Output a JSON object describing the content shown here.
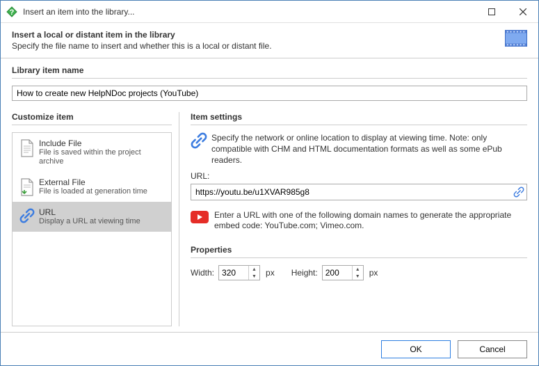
{
  "titlebar": {
    "title": "Insert an item into the library..."
  },
  "header": {
    "heading": "Insert a local or distant item in the library",
    "sub": "Specify the file name to insert and whether this is a local or distant file."
  },
  "libname": {
    "label": "Library item name",
    "value": "How to create new HelpNDoc projects (YouTube)"
  },
  "customize": {
    "label": "Customize item",
    "items": [
      {
        "title": "Include File",
        "sub": "File is saved within the project archive"
      },
      {
        "title": "External File",
        "sub": "File is loaded at generation time"
      },
      {
        "title": "URL",
        "sub": "Display a URL at viewing time"
      }
    ]
  },
  "settings": {
    "label": "Item settings",
    "desc": "Specify the network or online location to display at viewing time. Note: only compatible with CHM and HTML documentation formats as well as some ePub readers.",
    "url_label": "URL:",
    "url_value": "https://youtu.be/u1XVAR985g8",
    "note": "Enter a URL with one of the following domain names to generate the appropriate embed code: YouTube.com; Vimeo.com.",
    "props_label": "Properties",
    "width_label": "Width:",
    "width_value": "320",
    "height_label": "Height:",
    "height_value": "200",
    "unit": "px"
  },
  "footer": {
    "ok": "OK",
    "cancel": "Cancel"
  }
}
